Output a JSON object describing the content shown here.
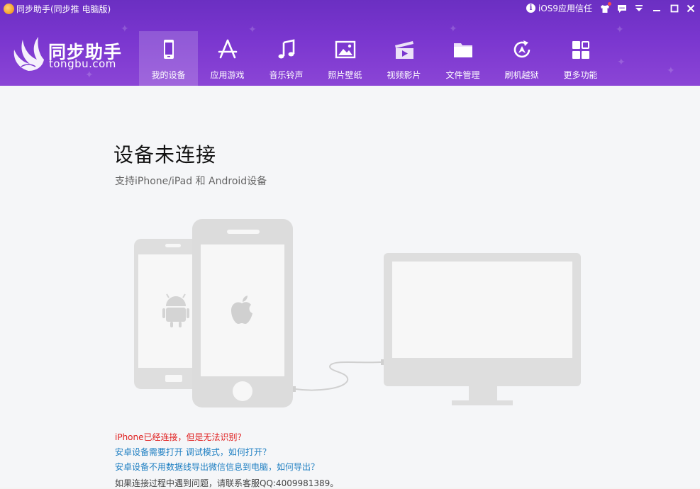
{
  "titlebar": {
    "app_title": "同步助手(同步推 电脑版)",
    "ios_trust": "iOS9应用信任",
    "buttons": [
      "skin-icon",
      "message-icon",
      "dropdown-icon",
      "minimize-icon",
      "maximize-icon",
      "close-icon"
    ]
  },
  "logo": {
    "cn": "同步助手",
    "en": "tongbu.com"
  },
  "nav": {
    "items": [
      {
        "label": "我的设备",
        "icon": "phone-icon",
        "active": true
      },
      {
        "label": "应用游戏",
        "icon": "app-store-icon"
      },
      {
        "label": "音乐铃声",
        "icon": "music-note-icon"
      },
      {
        "label": "照片壁纸",
        "icon": "photo-icon"
      },
      {
        "label": "视频影片",
        "icon": "video-icon"
      },
      {
        "label": "文件管理",
        "icon": "folder-icon"
      },
      {
        "label": "刷机越狱",
        "icon": "restore-icon"
      },
      {
        "label": "更多功能",
        "icon": "grid-icon"
      }
    ]
  },
  "main": {
    "headline": "设备未连接",
    "subline": "支持iPhone/iPad 和 Android设备",
    "links": [
      "iPhone已经连接，但是无法识别？",
      "安卓设备需要打开 调试模式，如何打开？",
      "安卓设备不用数据线导出微信信息到电脑，如何导出？",
      "如果连接过程中遇到问题，请联系客服QQ:4009981389。"
    ]
  },
  "colors": {
    "header": "#7a36cf",
    "link_red": "#e02020",
    "link_blue": "#1e7fc2",
    "device_grey": "#dcdcdc"
  }
}
